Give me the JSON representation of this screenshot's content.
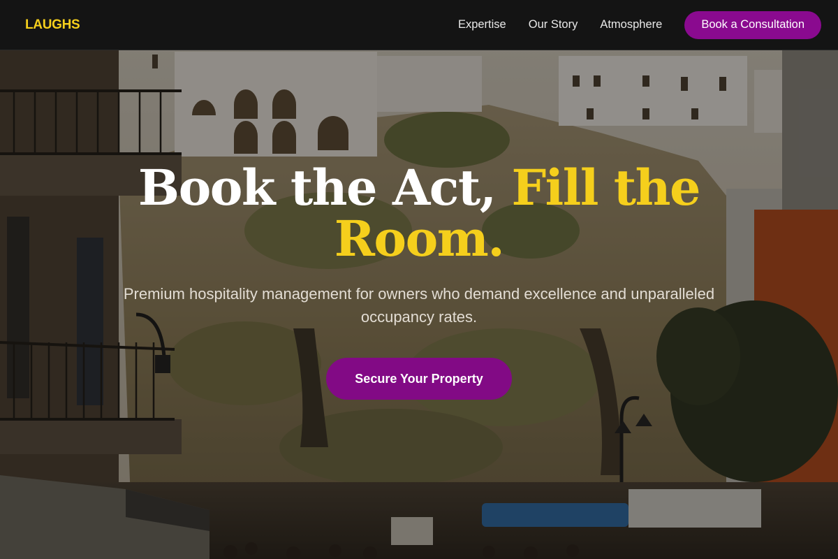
{
  "nav": {
    "logo": "LAUGHS",
    "links": [
      "Expertise",
      "Our Story",
      "Atmosphere"
    ],
    "cta": "Book a Consultation"
  },
  "hero": {
    "headline_white": "Book the Act, ",
    "headline_highlight": "Fill the Room.",
    "subtitle": "Premium hospitality management for owners who demand excellence and unparalleled occupancy rates.",
    "cta": "Secure Your Property",
    "background_image": "coastal-village-cliff-photo"
  },
  "colors": {
    "accent_yellow": "#f5cf1c",
    "brand_purple": "#8a0a8f",
    "nav_background": "#141414"
  }
}
